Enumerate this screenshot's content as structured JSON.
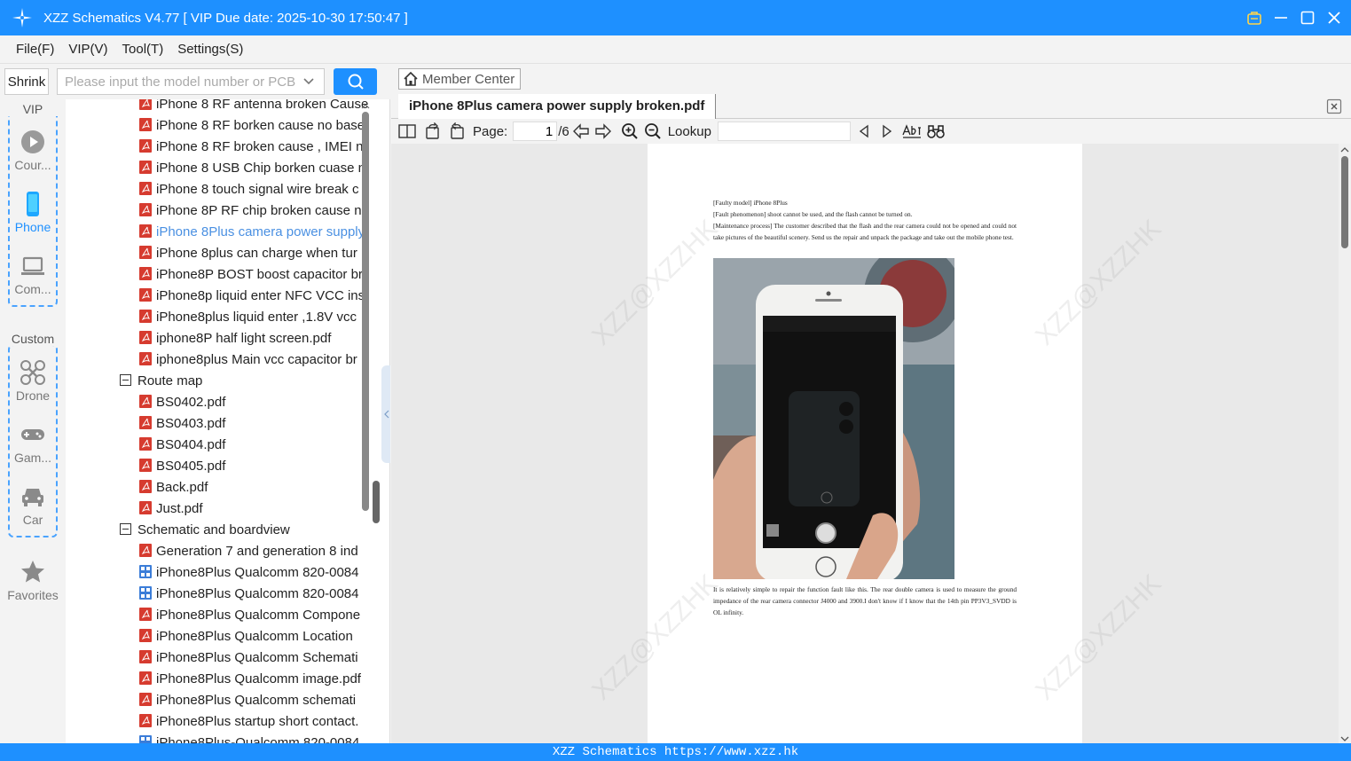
{
  "app": {
    "title": "XZZ Schematics V4.77 [ VIP Due date: 2025-10-30 17:50:47 ]"
  },
  "menu": [
    "File(F)",
    "VIP(V)",
    "Tool(T)",
    "Settings(S)"
  ],
  "search": {
    "shrink_label": "Shrink",
    "placeholder": "Please input the model number or PCB",
    "value": ""
  },
  "sidebar": {
    "vip_group_title": "VIP",
    "custom_group_title": "Custom",
    "items": [
      {
        "label": "Cour...",
        "icon": "play-circle-icon"
      },
      {
        "label": "Phone",
        "icon": "phone-icon"
      },
      {
        "label": "Com...",
        "icon": "laptop-icon"
      },
      {
        "label": "Drone",
        "icon": "drone-icon"
      },
      {
        "label": "Gam...",
        "icon": "gamepad-icon"
      },
      {
        "label": "Car",
        "icon": "car-icon"
      },
      {
        "label": "Favorites",
        "icon": "star-icon"
      }
    ],
    "accent": "#1e90ff"
  },
  "tree": {
    "items_top": [
      "iPhone 8 RF antenna broken Cause",
      "iPhone 8 RF borken cause no base",
      "iPhone 8 RF broken cause , IMEI n",
      "iPhone 8 USB Chip borken cuase n",
      "iPhone 8 touch signal wire break c",
      "iPhone 8P RF chip broken cause n",
      "iPhone 8Plus camera power supply",
      "iPhone 8plus can charge when tur",
      "iPhone8P BOST boost capacitor br",
      "iPhone8p liquid enter NFC VCC ins",
      "iPhone8plus liquid enter ,1.8V vcc",
      "iphone8P half light screen.pdf",
      "iphone8plus Main vcc capacitor br"
    ],
    "selected_index": 6,
    "route_map": {
      "label": "Route map",
      "items": [
        "BS0402.pdf",
        "BS0403.pdf",
        "BS0404.pdf",
        "BS0405.pdf",
        "Back.pdf",
        "Just.pdf"
      ]
    },
    "schematic": {
      "label": "Schematic and boardview",
      "items": [
        {
          "label": "Generation 7 and generation 8 ind",
          "kind": "pdf"
        },
        {
          "label": "iPhone8Plus Qualcomm 820-0084",
          "kind": "board"
        },
        {
          "label": "iPhone8Plus Qualcomm 820-0084",
          "kind": "board"
        },
        {
          "label": "iPhone8Plus Qualcomm Compone",
          "kind": "pdf"
        },
        {
          "label": "iPhone8Plus Qualcomm Location",
          "kind": "pdf"
        },
        {
          "label": "iPhone8Plus Qualcomm Schemati",
          "kind": "pdf"
        },
        {
          "label": "iPhone8Plus Qualcomm image.pdf",
          "kind": "pdf"
        },
        {
          "label": "iPhone8Plus Qualcomm schemati",
          "kind": "pdf"
        },
        {
          "label": "iPhone8Plus startup short contact.",
          "kind": "pdf"
        },
        {
          "label": "iPhone8Plus-Qualcomm 820-0084",
          "kind": "board"
        }
      ]
    }
  },
  "viewer": {
    "member_center": "Member Center",
    "tab_title": "iPhone 8Plus camera power supply broken.pdf",
    "page_label": "Page:",
    "page_current": "1",
    "page_total": "/6",
    "lookup_label": "Lookup",
    "lookup_value": "",
    "pdf": {
      "header_lines": [
        "[Faulty model] iPhone 8Plus",
        "[Fault phenomenon] shoot cannot be used, and the flash cannot be turned on.",
        "[Maintenance process] The customer described that the flash and the rear camera could not be opened and could not take pictures of the beautiful scenery. Send us the repair and unpack the package and take out the mobile phone test."
      ],
      "footer_text": "It is relatively simple to repair the function fault like this. The rear double camera is used to measure the ground impedance of the rear camera connector J4000 and 3900.I don't know if I know that the 14th pin PP3V3_SVDD is OL infinity.",
      "watermark": "XZZ@XZZHK"
    }
  },
  "status": {
    "text": "XZZ Schematics https://www.xzz.hk"
  },
  "colors": {
    "titlebar": "#1e90ff",
    "pdf_icon": "#d63b2f",
    "board_icon": "#3b7dd8",
    "selected_text": "#4a90e2"
  }
}
